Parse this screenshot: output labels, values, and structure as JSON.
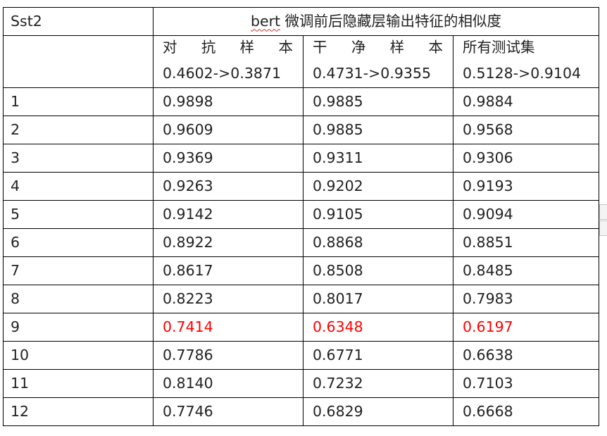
{
  "table": {
    "corner": "Sst2",
    "title_prefix": "bert",
    "title_rest": " 微调前后隐藏层输出特征的相似度",
    "columns": [
      {
        "name": "对 抗 样 本",
        "range": "0.4602->0.3871"
      },
      {
        "name": "干 净 样 本",
        "range": "0.4731->0.9355"
      },
      {
        "name": "所有测试集",
        "range": "0.5128->0.9104"
      }
    ],
    "rows": [
      {
        "layer": "1",
        "values": [
          "0.9898",
          "0.9885",
          "0.9884"
        ],
        "highlight": false
      },
      {
        "layer": "2",
        "values": [
          "0.9609",
          "0.9885",
          "0.9568"
        ],
        "highlight": false
      },
      {
        "layer": "3",
        "values": [
          "0.9369",
          "0.9311",
          "0.9306"
        ],
        "highlight": false
      },
      {
        "layer": "4",
        "values": [
          "0.9263",
          "0.9202",
          "0.9193"
        ],
        "highlight": false
      },
      {
        "layer": "5",
        "values": [
          "0.9142",
          "0.9105",
          "0.9094"
        ],
        "highlight": false
      },
      {
        "layer": "6",
        "values": [
          "0.8922",
          "0.8868",
          "0.8851"
        ],
        "highlight": false
      },
      {
        "layer": "7",
        "values": [
          "0.8617",
          "0.8508",
          "0.8485"
        ],
        "highlight": false
      },
      {
        "layer": "8",
        "values": [
          "0.8223",
          "0.8017",
          "0.7983"
        ],
        "highlight": false
      },
      {
        "layer": "9",
        "values": [
          "0.7414",
          "0.6348",
          "0.6197"
        ],
        "highlight": true
      },
      {
        "layer": "10",
        "values": [
          "0.7786",
          "0.6771",
          "0.6638"
        ],
        "highlight": false
      },
      {
        "layer": "11",
        "values": [
          "0.8140",
          "0.7232",
          "0.7103"
        ],
        "highlight": false
      },
      {
        "layer": "12",
        "values": [
          "0.7746",
          "0.6829",
          "0.6668"
        ],
        "highlight": false
      }
    ]
  },
  "colors": {
    "text": "#222222",
    "highlight": "#ff0000",
    "border": "#000000"
  }
}
